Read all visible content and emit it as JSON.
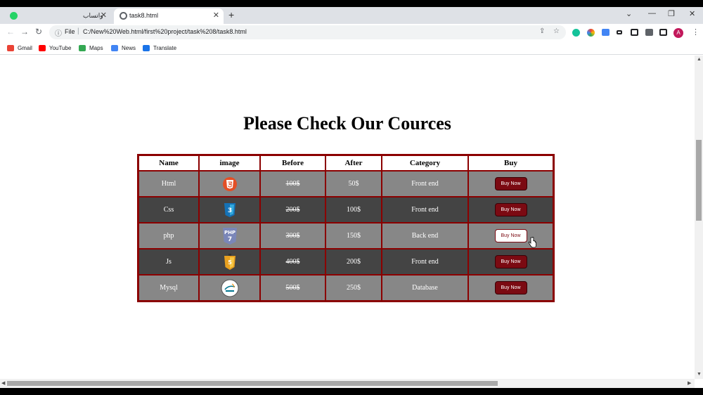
{
  "browser": {
    "tabs": [
      {
        "title": "واتساب",
        "favicon": "whatsapp-icon",
        "active": false
      },
      {
        "title": "task8.html",
        "favicon": "globe-icon",
        "active": true
      }
    ],
    "new_tab": "+",
    "address": {
      "scheme_label": "File",
      "url": "C:/New%20Web.html/first%20project/task%208/task8.html"
    },
    "bookmarks": [
      {
        "label": "Gmail",
        "icon": "gmail-icon",
        "color": "#ea4335"
      },
      {
        "label": "YouTube",
        "icon": "youtube-icon",
        "color": "#ff0000"
      },
      {
        "label": "Maps",
        "icon": "maps-icon",
        "color": "#34a853"
      },
      {
        "label": "News",
        "icon": "news-icon",
        "color": "#4285f4"
      },
      {
        "label": "Translate",
        "icon": "translate-icon",
        "color": "#4285f4"
      }
    ],
    "profile_initial": "A"
  },
  "page": {
    "heading": "Please Check Our Cources",
    "table": {
      "headers": [
        "Name",
        "image",
        "Before",
        "After",
        "Category",
        "Buy"
      ],
      "rows": [
        {
          "name": "Html",
          "logo": "html5-icon",
          "before": "100$",
          "after": "50$",
          "category": "Front end",
          "buy": "Buy Now"
        },
        {
          "name": "Css",
          "logo": "css3-icon",
          "before": "200$",
          "after": "100$",
          "category": "Front end",
          "buy": "Buy Now"
        },
        {
          "name": "php",
          "logo": "php7-icon",
          "before": "300$",
          "after": "150$",
          "category": "Back end",
          "buy": "Buy Now"
        },
        {
          "name": "Js",
          "logo": "js-shield-icon",
          "before": "400$",
          "after": "200$",
          "category": "Front end",
          "buy": "Buy Now"
        },
        {
          "name": "Mysql",
          "logo": "mysql-icon",
          "before": "500$",
          "after": "250$",
          "category": "Database",
          "buy": "Buy Now"
        }
      ]
    },
    "colors": {
      "border": "#8b0000",
      "light_row": "#878787",
      "dark_row": "#444444",
      "button": "#7b0a12"
    }
  }
}
